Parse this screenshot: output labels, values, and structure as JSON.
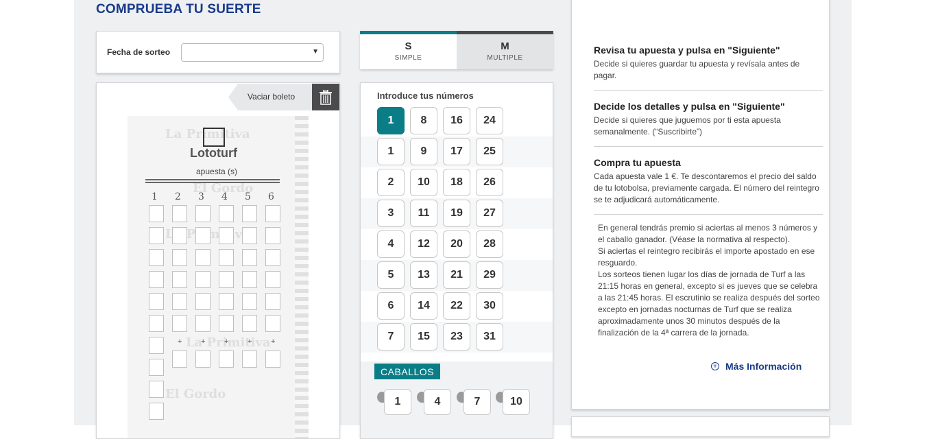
{
  "page_title": "COMPRUEBA TU SUERTE",
  "fecha": {
    "label": "Fecha de sorteo",
    "selected": ""
  },
  "boleto": {
    "vaciar_label": "Vaciar boleto",
    "logo_text": "Lototurf",
    "apuesta_label": "apuesta (s)",
    "equals_line": "=======================",
    "columns": [
      "1",
      "2",
      "3",
      "4",
      "5",
      "6"
    ],
    "watermark_top": "La Primitiva",
    "watermark_mid": "El Gordo",
    "watermark_bottom": "La Primitiva",
    "watermark_end": "El Gordo"
  },
  "tabs": [
    {
      "letter": "S",
      "label": "SIMPLE",
      "active": true
    },
    {
      "letter": "M",
      "label": "MULTIPLE",
      "active": false
    }
  ],
  "numbers": {
    "heading": "Introduce tus números",
    "rows": [
      [
        "1",
        "8",
        "16",
        "24"
      ],
      [
        "1",
        "9",
        "17",
        "25"
      ],
      [
        "2",
        "10",
        "18",
        "26"
      ],
      [
        "3",
        "11",
        "19",
        "27"
      ],
      [
        "4",
        "12",
        "20",
        "28"
      ],
      [
        "5",
        "13",
        "21",
        "29"
      ],
      [
        "6",
        "14",
        "22",
        "30"
      ],
      [
        "7",
        "15",
        "23",
        "31"
      ]
    ],
    "selected": "1"
  },
  "caballos": {
    "label": "CABALLOS",
    "items": [
      "1",
      "4",
      "7",
      "10"
    ]
  },
  "info": {
    "steps": [
      {
        "title": "Revisa tu apuesta y pulsa en \"Siguiente\"",
        "text": "Decide si quieres guardar tu apuesta y revísala antes de pagar."
      },
      {
        "title": "Decide los detalles y pulsa en \"Siguiente\"",
        "text": "Decide si quieres que juguemos por ti esta apuesta semanalmente. (“Suscribirte”)"
      },
      {
        "title": "Compra tu apuesta",
        "text": "Cada apuesta vale 1 €. Te descontaremos el precio del saldo de tu lotobolsa, previamente cargada. El número del reintegro se te adjudicará automáticamente."
      }
    ],
    "general": [
      "En general tendrás premio si aciertas al menos 3 números y el caballo ganador. (Véase la normativa al respecto).",
      "Si aciertas el reintegro recibirás el importe apostado en ese resguardo.",
      "Los sorteos tienen lugar los días de jornada de Turf a las 21:15 horas en general, excepto si es jueves que se celebra a las 21:45 horas. El escrutinio se realiza después del sorteo excepto en jornadas nocturnas de Turf que se realiza aproximadamente unos 30 minutos después de la finalización de la 4ª carrera de la jornada."
    ],
    "mas_info": "Más Información",
    "mas_icon": "plus-circle-icon"
  },
  "colors": {
    "accent": "#0a7d87",
    "title": "#1a3a8a",
    "dark": "#4b4b4d"
  }
}
